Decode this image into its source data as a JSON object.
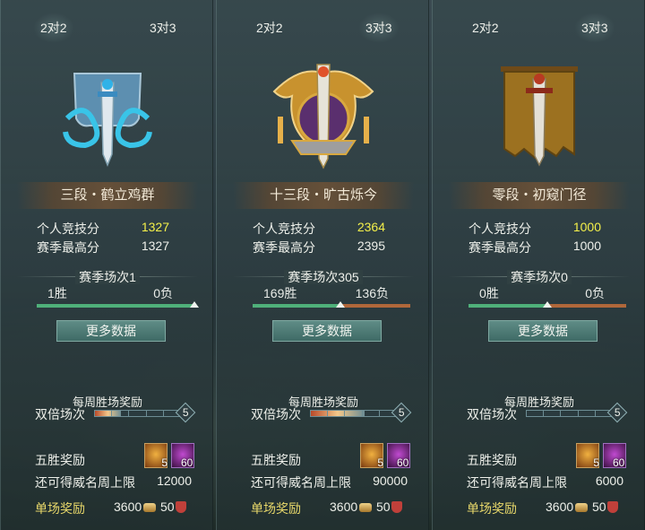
{
  "panels": [
    {
      "tab_2v2": "2对2",
      "tab_3v3": "3对3",
      "active_tab": "2v2",
      "emblem_icon": "banner-sword-dragon-icon",
      "rank": "三段・鹤立鸡群",
      "personal_score_label": "个人竞技分",
      "personal_score": "1327",
      "season_high_label": "赛季最高分",
      "season_high": "1327",
      "season_games": "赛季场次1",
      "wins": "1胜",
      "losses": "0负",
      "win_ratio": 1.0,
      "more_button": "更多数据",
      "weekly_title": "每周胜场奖励",
      "double_label": "双倍场次",
      "double_progress": 0.3,
      "double_cap": "5",
      "five_win_label": "五胜奖励",
      "item1_count": "5",
      "item2_count": "60",
      "cap_label": "还可得威名周上限",
      "cap_value": "12000",
      "single_label": "单场奖励",
      "single_coins": "3600",
      "single_points": "50"
    },
    {
      "tab_2v2": "2对2",
      "tab_3v3": "3对3",
      "active_tab": "3v3",
      "emblem_icon": "golden-winged-sword-crest-icon",
      "rank": "十三段・旷古烁今",
      "personal_score_label": "个人竞技分",
      "personal_score": "2364",
      "season_high_label": "赛季最高分",
      "season_high": "2395",
      "season_games": "赛季场次305",
      "wins": "169胜",
      "losses": "136负",
      "win_ratio": 0.554,
      "more_button": "更多数据",
      "weekly_title": "每周胜场奖励",
      "double_label": "双倍场次",
      "double_progress": 0.62,
      "double_cap": "5",
      "five_win_label": "五胜奖励",
      "item1_count": "5",
      "item2_count": "60",
      "cap_label": "还可得威名周上限",
      "cap_value": "90000",
      "single_label": "单场奖励",
      "single_coins": "3600",
      "single_points": "50"
    },
    {
      "tab_2v2": "2对2",
      "tab_3v3": "3对3",
      "active_tab": "3v3",
      "emblem_icon": "tattered-banner-sword-icon",
      "rank": "零段・初窥门径",
      "personal_score_label": "个人竞技分",
      "personal_score": "1000",
      "season_high_label": "赛季最高分",
      "season_high": "1000",
      "season_games": "赛季场次0",
      "wins": "0胜",
      "losses": "0负",
      "win_ratio": 0.5,
      "more_button": "更多数据",
      "weekly_title": "每周胜场奖励",
      "double_label": "双倍场次",
      "double_progress": 0.0,
      "double_cap": "5",
      "five_win_label": "五胜奖励",
      "item1_count": "5",
      "item2_count": "60",
      "cap_label": "还可得威名周上限",
      "cap_value": "6000",
      "single_label": "单场奖励",
      "single_coins": "3600",
      "single_points": "50"
    }
  ],
  "colors": {
    "score_highlight": "#f4f04a",
    "single_reward_label": "#e8d86a",
    "win_bar": "#4fb07a",
    "loss_bar": "#b0673a"
  }
}
